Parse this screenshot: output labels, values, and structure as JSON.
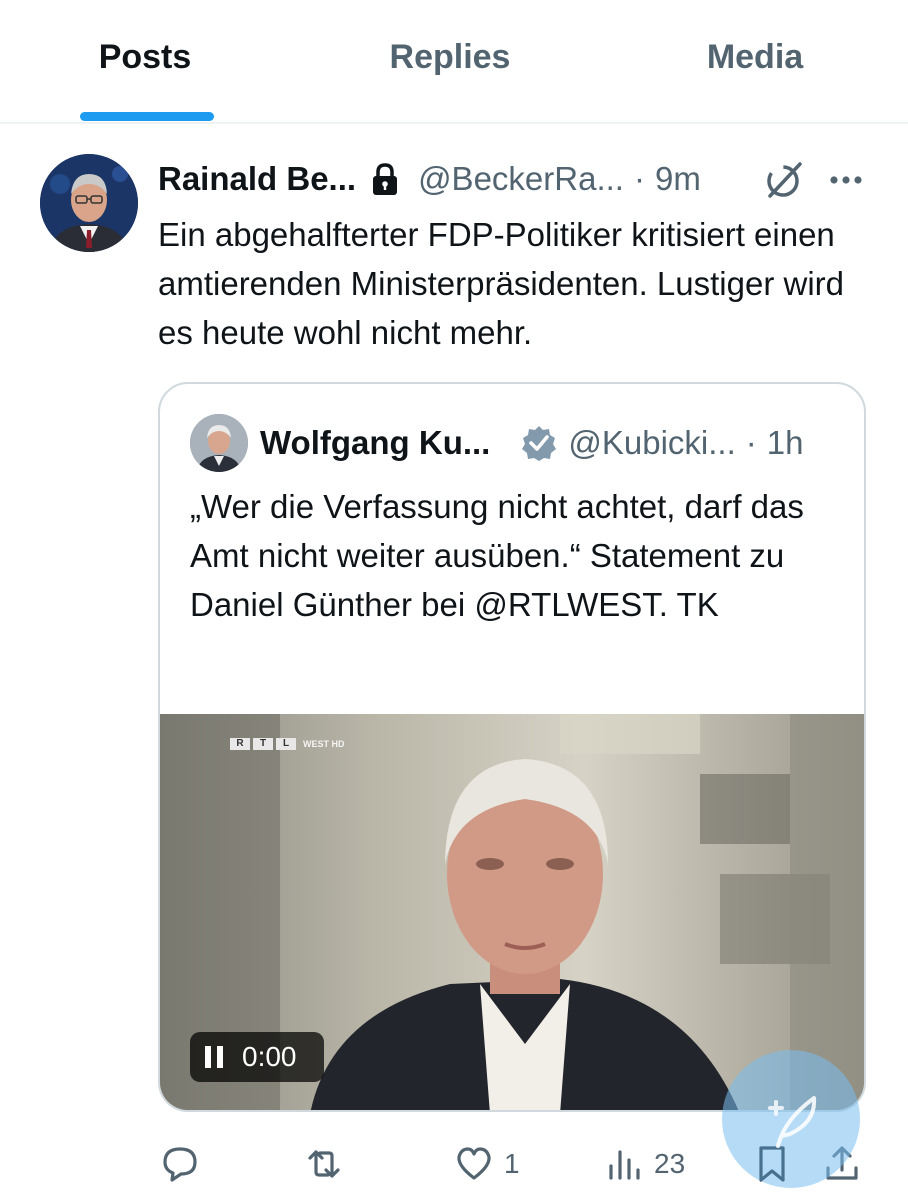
{
  "tabs": [
    {
      "label": "Posts",
      "active": true
    },
    {
      "label": "Replies",
      "active": false
    },
    {
      "label": "Media",
      "active": false
    }
  ],
  "tweet": {
    "display_name": "Rainald Be...",
    "handle": "@BeckerRa...",
    "separator": "·",
    "time": "9m",
    "text": "Ein abgehalfterter FDP-Politiker kritisiert einen amtierenden Ministerpräsidenten. Lustiger wird es heute wohl nicht mehr.",
    "icons": [
      "lock-icon",
      "grok-icon",
      "more-icon"
    ]
  },
  "quote": {
    "display_name": "Wolfgang Ku...",
    "handle": "@Kubicki...",
    "separator": "·",
    "time": "1h",
    "text": "„Wer die Verfassung nicht achtet, darf das Amt nicht weiter ausüben.“ Statement zu Daniel Günther bei @RTLWEST. TK",
    "video": {
      "channel_letters": [
        "R",
        "T",
        "L"
      ],
      "channel_suffix": "WEST HD",
      "timestamp": "0:00",
      "state": "playing"
    }
  },
  "actions": {
    "reply_count": "",
    "repost_count": "",
    "like_count": "1",
    "views_count": "23"
  },
  "colors": {
    "accent": "#1d9bf0",
    "text_primary": "#0f1419",
    "text_secondary": "#536471",
    "border": "#cfd9de",
    "verified": "#829aab"
  }
}
